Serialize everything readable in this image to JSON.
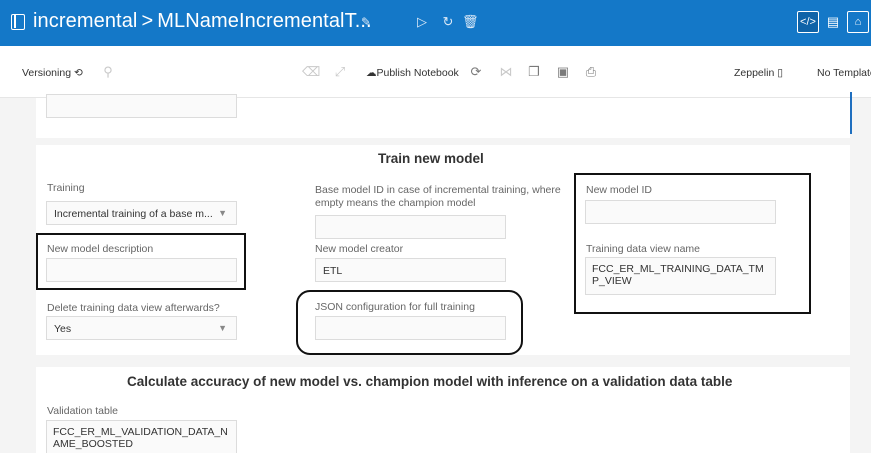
{
  "titlebar": {
    "breadcrumb_parent": "incremental",
    "separator": ">",
    "notebook_name": "MLNameIncrementalT...",
    "right_buttons": [
      "code-view",
      "document",
      "lock"
    ],
    "accent_color": "#1478c8"
  },
  "toolbar": {
    "versioning_label": "Versioning",
    "publish_label": "Publish Notebook",
    "interpreter_label": "Zeppelin",
    "template_label": "No Template"
  },
  "train_section": {
    "title": "Train new model",
    "training": {
      "label": "Training",
      "value": "Incremental training of a base m..."
    },
    "base_model_id": {
      "label": "Base model ID in case of incremental training, where empty means the champion model",
      "value": ""
    },
    "new_model_id": {
      "label": "New model ID",
      "value": ""
    },
    "new_model_description": {
      "label": "New model description",
      "value": ""
    },
    "new_model_creator": {
      "label": "New model creator",
      "value": "ETL"
    },
    "training_data_view": {
      "label": "Training data view name",
      "value": "FCC_ER_ML_TRAINING_DATA_TMP_VIEW"
    },
    "delete_view": {
      "label": "Delete training data view afterwards?",
      "value": "Yes"
    },
    "json_config": {
      "label": "JSON configuration for full training",
      "value": ""
    }
  },
  "accuracy_section": {
    "title": "Calculate accuracy of new model vs. champion model with inference on a validation data table",
    "validation_table": {
      "label": "Validation table",
      "value": "FCC_ER_ML_VALIDATION_DATA_NAME_BOOSTED"
    }
  }
}
